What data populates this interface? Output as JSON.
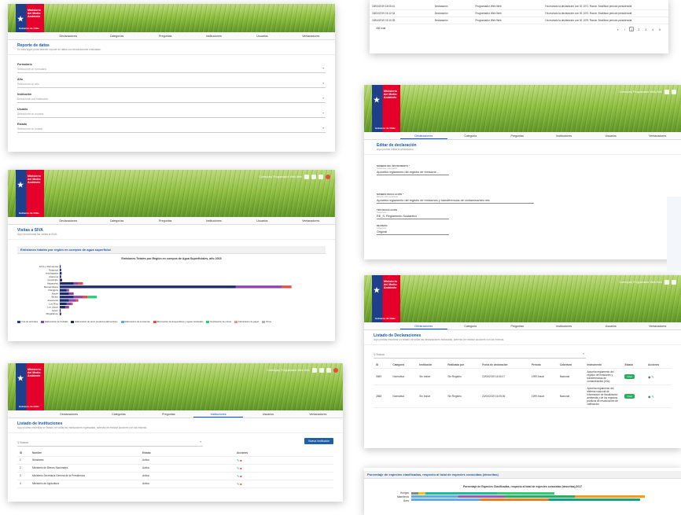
{
  "header": {
    "ministry": "Ministerio del Medio Ambiente",
    "gov": "Gobierno de Chile",
    "user": "Correo(as) Programador Web-Web"
  },
  "tabs": [
    "Declaraciones",
    "Categorías",
    "Preguntas",
    "Instituciones",
    "Usuarios",
    "Ventanadores"
  ],
  "tabs_b": [
    "Declaraciones",
    "Categoría",
    "Preguntas",
    "Instituciones",
    "Usuarios",
    "Ventanadores"
  ],
  "reporte": {
    "title": "Reporte de datos",
    "subtitle": "En esta lugar podrá obtener reporte de datos con declaraciones realizadas.",
    "fields": [
      {
        "label": "Formulario",
        "placeholder": "Seleccione un formulario"
      },
      {
        "label": "Año",
        "placeholder": "Seleccione un año"
      },
      {
        "label": "Institución",
        "placeholder": "Seleccione una institución"
      },
      {
        "label": "Usuario",
        "placeholder": "Seleccione un usuario"
      },
      {
        "label": "Estado",
        "placeholder": "Seleccione un estado"
      }
    ]
  },
  "historial": {
    "rows": [
      {
        "date": "15/04/2019 18:05:41",
        "type": "Declaración",
        "user": "Programador Web Web",
        "desc": "Ha enviado la declaración con ID 1071. Razón: Modificar periodo presidencial"
      },
      {
        "date": "15/04/2019 15:12:34",
        "type": "Declaración",
        "user": "Programador Web Web",
        "desc": "Ha enviado la declaración con ID 1070. Razón: Modificar periodo presidencial"
      },
      {
        "date": "15/04/2019 15:10:35",
        "type": "Declaración",
        "user": "Programador Web Web",
        "desc": "Ha enviado la declaración con ID 1079. Razón: Modificar periodo presidencial"
      }
    ],
    "total": "406 total",
    "pages": [
      "«",
      "‹",
      "1",
      "2",
      "3",
      "4",
      "5"
    ]
  },
  "visitas": {
    "title": "Visitas a SIVA",
    "subtitle": "Aquí encontrarás las visitas al SIVA.",
    "section": "Emisiones totales por región en cuerpos de agua superficial",
    "chart_title": "Emisiones Totales por Región en cuerpos de Agua Superficiales, año 2015",
    "legend": [
      {
        "name": "Cría de animales",
        "color": "#2c3e8c"
      },
      {
        "name": "Elaboración de bebidas",
        "color": "#8e44ad"
      },
      {
        "name": "Elaboración de otros productos alimenticios",
        "color": "#1c2a6b"
      },
      {
        "name": "Elaboración de conservas",
        "color": "#5dade2"
      },
      {
        "name": "Eliminación de desperdicios y aguas residuales",
        "color": "#e74c3c"
      },
      {
        "name": "Explotación de minas",
        "color": "#2ecc71"
      },
      {
        "name": "Fabricación de papel",
        "color": "#f1948a"
      },
      {
        "name": "Otros",
        "color": "#aab7b8"
      }
    ]
  },
  "chart_data": {
    "type": "bar",
    "title": "Emisiones Totales por Región en cuerpos de Agua Superficiales, año 2015",
    "categories": [
      "Arica y Parinacota",
      "Tarapacá",
      "Antofagasta",
      "Atacama",
      "Coquimbo",
      "Valparaíso",
      "Metropolitana",
      "O'Higgins",
      "Maule",
      "Biobío",
      "Araucanía",
      "Los Ríos",
      "Los Lagos",
      "Aysén",
      "Magallanes"
    ],
    "series": [
      {
        "name": "Cría de animales",
        "values": [
          0.2,
          0.3,
          0.4,
          0.3,
          0.5,
          3,
          38,
          1.5,
          2,
          3,
          2,
          1.5,
          1.2,
          0.2,
          0.3
        ]
      },
      {
        "name": "Elaboración de bebidas",
        "values": [
          0,
          0,
          0,
          0,
          0,
          1,
          10,
          0.5,
          1,
          2,
          1.5,
          1,
          0.8,
          0,
          0
        ]
      },
      {
        "name": "Eliminación de desperdicios y aguas residuales",
        "values": [
          0,
          0,
          0,
          0,
          0,
          1,
          2,
          0,
          0,
          1,
          0.5,
          0.3,
          0,
          0,
          0
        ]
      },
      {
        "name": "Explotación de minas",
        "values": [
          0,
          0,
          0,
          0,
          0,
          0,
          0,
          0,
          0,
          2,
          0,
          0,
          0,
          0,
          0
        ]
      }
    ]
  },
  "instituciones": {
    "title": "Listado de Instituciones",
    "subtitle": "Aquí podrás encontrar un listado de todas las instituciones ingresadas, además de realizar acciones con las mismas.",
    "search_placeholder": "Buscar",
    "new_button": "Nueva Institución",
    "headers": [
      "ID",
      "Nombre",
      "Estado",
      "Acciones"
    ],
    "rows": [
      {
        "id": "1",
        "name": "Ninistarea",
        "state": "Activa"
      },
      {
        "id": "2",
        "name": "Ministerio de Bienes Nacionales",
        "state": "Activa"
      },
      {
        "id": "3",
        "name": "Ministerio Secretaría General de la Presidencia",
        "state": "Activa"
      },
      {
        "id": "4",
        "name": "Ministerio de Agricultura",
        "state": "Activa"
      }
    ]
  },
  "editar": {
    "title": "Editar de declaración",
    "subtitle": "Aquí podrás editar la declaración.",
    "fields": [
      {
        "label": "Nombre del instrumento *",
        "hint": "Seleccione una opción",
        "value": "Aprueba reglamento del registro de emisione..."
      },
      {
        "label": "Nombre regulación *",
        "hint": "Máximo 100 caracteres",
        "value": "Aprueba reglamento del registro de emisiones y transferencias de contaminantes retc"
      },
      {
        "label": "Tipo regulación",
        "hint": "Seleccione",
        "value": "RE_S: Reglamento Sustantivo"
      },
      {
        "label": "Revisión",
        "hint": "Seleccione",
        "value": "Original"
      }
    ]
  },
  "declaraciones": {
    "title": "Listado de Declaraciones",
    "subtitle": "Aquí podrás encontrar un listado de todas las declaraciones realizadas, además de realizar acciones con las mismas.",
    "search_placeholder": "Buscar",
    "headers": [
      "ID",
      "Categoría",
      "Institución",
      "Realizada por",
      "Fecha de declaración",
      "Periodo",
      "Cobertura",
      "Instrumento",
      "Estado",
      "Acciones"
    ],
    "rows": [
      {
        "id": "2669",
        "cat": "Normativa",
        "inst": "Sin índice",
        "by": "Sin Registro",
        "date": "22/04/2019 16:06:17",
        "period": "1999 Anual",
        "cov": "Nacional",
        "instr": "Aprueba reglamento del registro de emisiones y transferencias de contaminantes (retc)",
        "state": "Final"
      },
      {
        "id": "2668",
        "cat": "Normativa",
        "inst": "Sin índice",
        "by": "Sin Registro",
        "date": "22/04/2019 16:05:06",
        "period": "1999 Anual",
        "cov": "Nacional",
        "instr": "Aprueba reglamento del sistema nacional de información de fiscalización ambiental y de los registros públicos de resoluciones de calificación",
        "state": "Final"
      }
    ]
  },
  "especies": {
    "section": "Porcentaje de especies clasificadas, respecto al total de especies conocidas (descritas)",
    "chart_title": "Porcentaje de Especies Clasificadas, respecto al total de especies conocidas (descritas),2017",
    "categories": [
      "Hongos",
      "Mamíferos",
      "Aves"
    ]
  }
}
